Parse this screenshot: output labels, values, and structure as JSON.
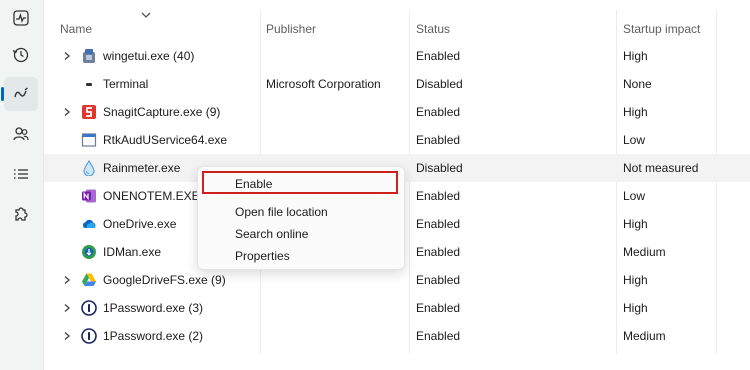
{
  "sidebar": {
    "items": [
      {
        "name": "performance",
        "icon": "activity-icon"
      },
      {
        "name": "app-history",
        "icon": "history-icon"
      },
      {
        "name": "startup-apps",
        "icon": "speedometer-icon",
        "active": true
      },
      {
        "name": "users",
        "icon": "users-icon"
      },
      {
        "name": "details",
        "icon": "list-icon"
      },
      {
        "name": "services",
        "icon": "puzzle-icon"
      }
    ],
    "accent": "#0067c0"
  },
  "table": {
    "columns": {
      "name": "Name",
      "publisher": "Publisher",
      "status": "Status",
      "impact": "Startup impact"
    },
    "rows": [
      {
        "name": "wingetui.exe (40)",
        "publisher": "",
        "status": "Enabled",
        "impact": "High",
        "expandable": true,
        "icon": "wingetui-icon"
      },
      {
        "name": "Terminal",
        "publisher": "Microsoft Corporation",
        "status": "Disabled",
        "impact": "None",
        "expandable": false,
        "icon": "terminal-icon"
      },
      {
        "name": "SnagitCapture.exe (9)",
        "publisher": "",
        "status": "Enabled",
        "impact": "High",
        "expandable": true,
        "icon": "snagit-icon"
      },
      {
        "name": "RtkAudUService64.exe",
        "publisher": "",
        "status": "Enabled",
        "impact": "Low",
        "expandable": false,
        "icon": "application-icon"
      },
      {
        "name": "Rainmeter.exe",
        "publisher": "",
        "status": "Disabled",
        "impact": "Not measured",
        "expandable": false,
        "icon": "rainmeter-icon"
      },
      {
        "name": "ONENOTEM.EXE",
        "publisher": "",
        "status": "Enabled",
        "impact": "Low",
        "expandable": false,
        "icon": "onenote-icon"
      },
      {
        "name": "OneDrive.exe",
        "publisher": "",
        "status": "Enabled",
        "impact": "High",
        "expandable": false,
        "icon": "onedrive-icon"
      },
      {
        "name": "IDMan.exe",
        "publisher": "",
        "status": "Enabled",
        "impact": "Medium",
        "expandable": false,
        "icon": "idm-icon"
      },
      {
        "name": "GoogleDriveFS.exe (9)",
        "publisher": "",
        "status": "Enabled",
        "impact": "High",
        "expandable": true,
        "icon": "google-drive-icon"
      },
      {
        "name": "1Password.exe (3)",
        "publisher": "",
        "status": "Enabled",
        "impact": "High",
        "expandable": true,
        "icon": "1password-icon"
      },
      {
        "name": "1Password.exe (2)",
        "publisher": "",
        "status": "Enabled",
        "impact": "Medium",
        "expandable": true,
        "icon": "1password-icon"
      }
    ]
  },
  "context_menu": {
    "items": [
      "Enable",
      "Open file location",
      "Search online",
      "Properties"
    ],
    "highlight_color": "#d01f1f"
  }
}
